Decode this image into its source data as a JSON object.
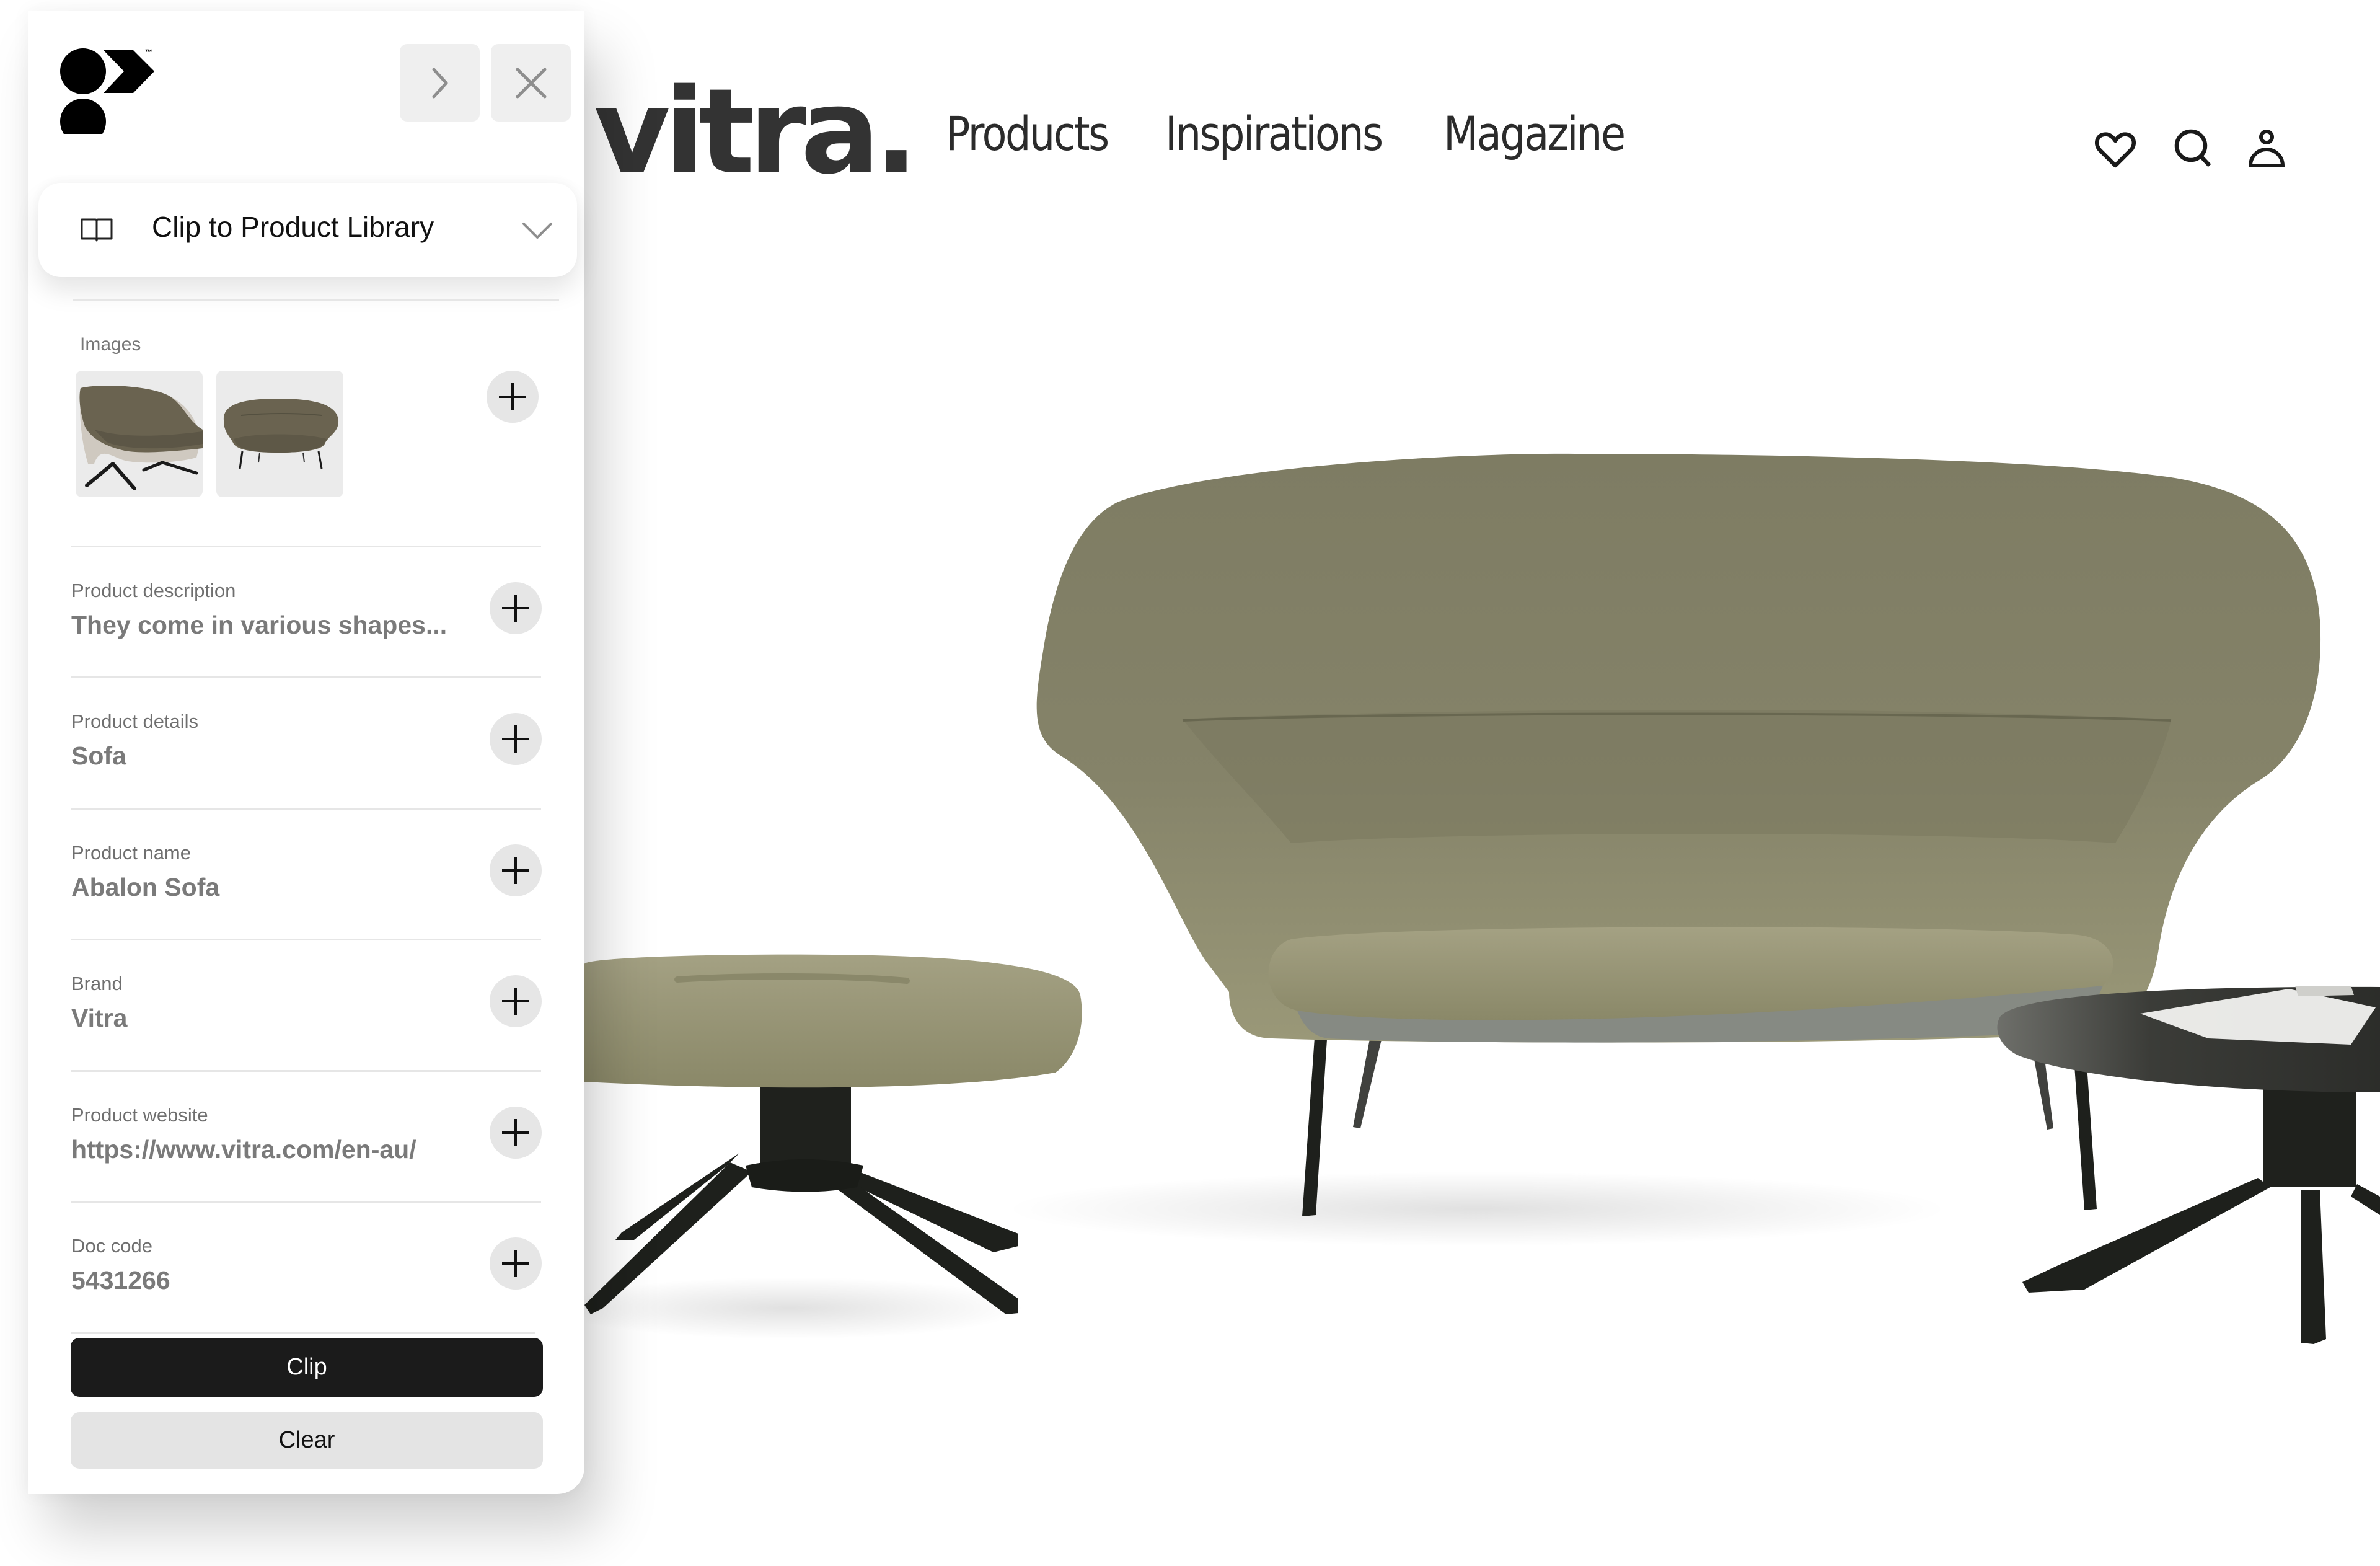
{
  "site": {
    "brand_logo": "vitra.",
    "nav": [
      "Products",
      "Inspirations",
      "Magazine"
    ],
    "icons": [
      "heart-icon",
      "search-icon",
      "user-icon"
    ],
    "hero_alt": "Abalon Sofa with ottoman and side table",
    "colors": {
      "fabric": "#7e7c63",
      "fabric_light": "#9a9878",
      "metal": "#1e201c",
      "table_top": "#3a3b37"
    }
  },
  "panel": {
    "logo_tm": "™",
    "collapse_icon": "chevron-right-icon",
    "close_icon": "close-icon",
    "destination": {
      "icon": "book-icon",
      "label": "Clip to Product Library",
      "chevron": "chevron-down-icon"
    },
    "images": {
      "label": "Images",
      "count": 2
    },
    "fields": [
      {
        "label": "Product description",
        "value": "They come in various shapes..."
      },
      {
        "label": "Product details",
        "value": "Sofa"
      },
      {
        "label": "Product name",
        "value": "Abalon Sofa"
      },
      {
        "label": "Brand",
        "value": "Vitra"
      },
      {
        "label": "Product website",
        "value": "https://www.vitra.com/en-au/"
      },
      {
        "label": "Doc code",
        "value": "5431266"
      }
    ],
    "buttons": {
      "clip": "Clip",
      "clear": "Clear"
    },
    "colors": {
      "primary": "#1b1b1b",
      "secondary": "#e4e4e4",
      "muted_text": "#7a7a7a"
    }
  }
}
